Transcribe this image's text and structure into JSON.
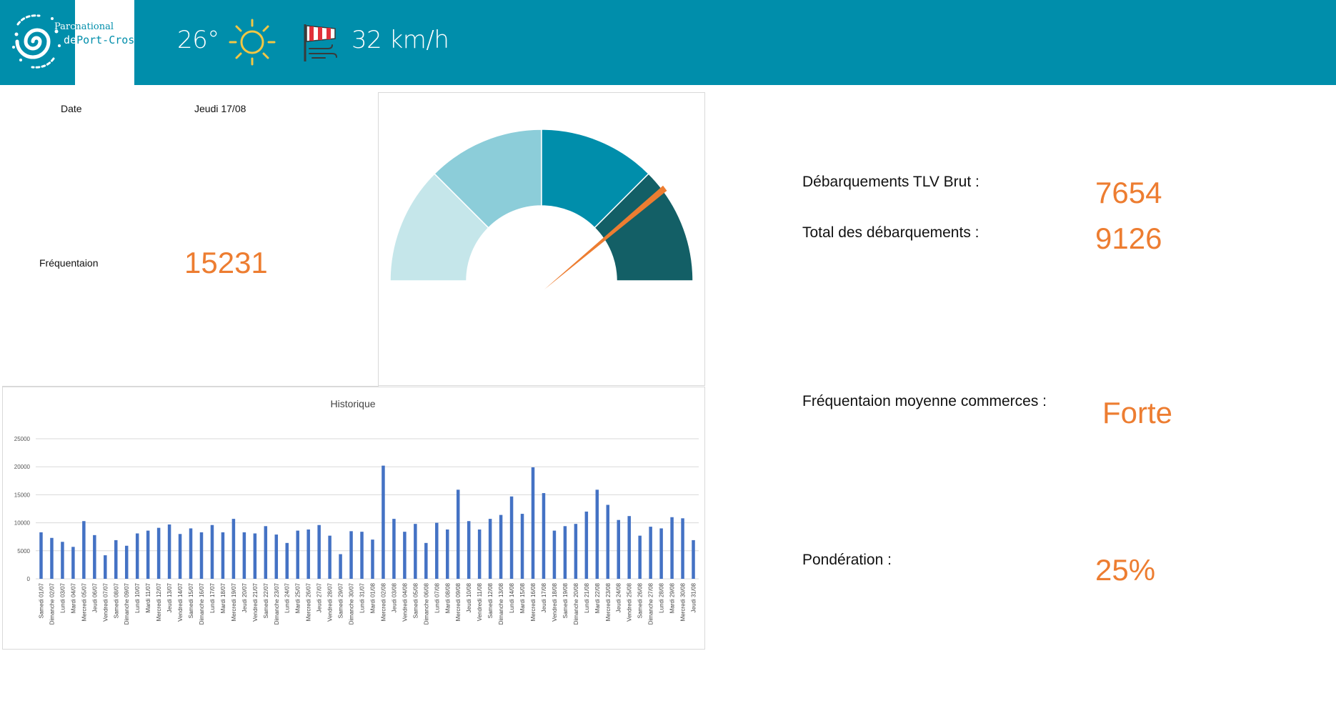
{
  "header": {
    "logo_text_line1_a": "Parc",
    "logo_text_line1_b": "national",
    "logo_text_line2_a": "de",
    "logo_text_line2_b": "Port-Cros",
    "temperature": "26°",
    "wind_speed": "32 km/h",
    "weather_icon": "sun-icon",
    "wind_icon": "windsock-icon",
    "colors": {
      "bar": "#008eab",
      "accent": "#ed7d31"
    }
  },
  "left": {
    "date_label": "Date",
    "date_value": "Jeudi 17/08",
    "frequentation_label": "Fréquentaion",
    "frequentation_value": "15231"
  },
  "right": {
    "tlv_label": "Débarquements TLV Brut :",
    "tlv_value": "7654",
    "total_label": "Total des débarquements  :",
    "total_value": "9126",
    "commerce_label": "Fréquentaion moyenne commerces :",
    "commerce_value": "Forte",
    "ponderation_label": "Pondération :",
    "ponderation_value": "25%"
  },
  "chart_data": [
    {
      "type": "gauge",
      "segments": [
        {
          "value": 25,
          "color": "#c5e6ea"
        },
        {
          "value": 25,
          "color": "#8ccdd9"
        },
        {
          "value": 25,
          "color": "#008eab"
        },
        {
          "value": 25,
          "color": "#135f66"
        }
      ],
      "needle_fraction": 0.795,
      "needle_color": "#ed7d31"
    },
    {
      "type": "bar",
      "title": "Historique",
      "ylim": [
        0,
        25000
      ],
      "yticks": [
        "0",
        "5000",
        "10000",
        "15000",
        "20000",
        "25000"
      ],
      "grid": true,
      "color": "#4472c4",
      "categories": [
        "Samedi 01/07",
        "Dimanche 02/07",
        "Lundi 03/07",
        "Mardi 04/07",
        "Mercredi 05/07",
        "Jeudi 06/07",
        "Vendredi 07/07",
        "Samedi 08/07",
        "Dimanche 09/07",
        "Lundi 10/07",
        "Mardi 11/07",
        "Mercredi 12/07",
        "Jeudi 13/07",
        "Vendredi 14/07",
        "Samedi 15/07",
        "Dimanche 16/07",
        "Lundi 17/07",
        "Mardi 18/07",
        "Mercredi 19/07",
        "Jeudi 20/07",
        "Vendredi 21/07",
        "Samedi 22/07",
        "Dimanche 23/07",
        "Lundi 24/07",
        "Mardi 25/07",
        "Mercredi 26/07",
        "Jeudi 27/07",
        "Vendredi 28/07",
        "Samedi 29/07",
        "Dimanche 30/07",
        "Lundi 31/07",
        "Mardi 01/08",
        "Mercredi 02/08",
        "Jeudi 03/08",
        "Vendredi 04/08",
        "Samedi 05/08",
        "Dimanche 06/08",
        "Lundi 07/08",
        "Mardi 08/08",
        "Mercredi 09/08",
        "Jeudi 10/08",
        "Vendredi 11/08",
        "Samedi 12/08",
        "Dimanche 13/08",
        "Lundi 14/08",
        "Mardi 15/08",
        "Mercredi 16/08",
        "Jeudi 17/08",
        "Vendredi 18/08",
        "Samedi 19/08",
        "Dimanche 20/08",
        "Lundi 21/08",
        "Mardi 22/08",
        "Mercredi 23/08",
        "Jeudi 24/08",
        "Vendredi 25/08",
        "Samedi 26/08",
        "Dimanche 27/08",
        "Lundi 28/08",
        "Mardi 29/08",
        "Mercredi 30/08",
        "Jeudi 31/08"
      ],
      "values": [
        8300,
        7300,
        6600,
        5700,
        10300,
        7800,
        4200,
        6900,
        5900,
        8100,
        8600,
        9100,
        9700,
        8000,
        9000,
        8300,
        9600,
        8300,
        10700,
        8300,
        8100,
        9400,
        7900,
        6400,
        8600,
        8800,
        9600,
        7700,
        4400,
        8500,
        8400,
        7000,
        20200,
        10700,
        8400,
        9800,
        6400,
        10000,
        8800,
        15900,
        10300,
        8800,
        10700,
        11400,
        14700,
        11600,
        19900,
        15300,
        8600,
        9400,
        9800,
        12000,
        15900,
        13200,
        10500,
        11200,
        7700,
        9300,
        9000,
        11000,
        10800,
        6900
      ]
    }
  ]
}
